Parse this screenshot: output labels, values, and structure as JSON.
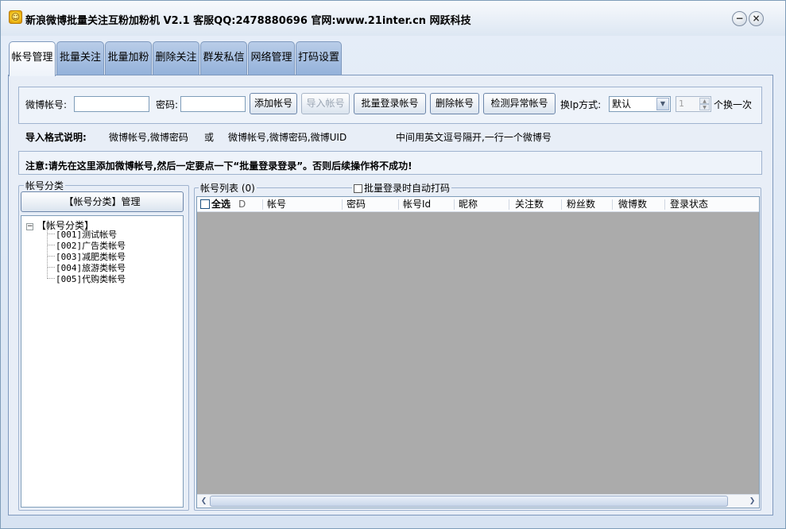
{
  "window": {
    "title": "新浪微博批量关注互粉加粉机 V2.1 客服QQ:2478880696 官网:www.21inter.cn 网跃科技",
    "icon": "app-smiley-icon",
    "minimize": "−",
    "close": "×"
  },
  "tabs": [
    "帐号管理",
    "批量关注",
    "批量加粉",
    "删除关注",
    "群发私信",
    "网络管理",
    "打码设置"
  ],
  "account_form": {
    "weibo_label": "微博帐号:",
    "weibo_value": "",
    "password_label": "密码:",
    "password_value": "",
    "add_button": "添加帐号",
    "import_button": "导入帐号",
    "batch_login_button": "批量登录帐号",
    "delete_button": "删除帐号",
    "check_button": "检测异常帐号",
    "ip_label": "换Ip方式:",
    "ip_mode": "默认",
    "spin_value": "1",
    "spin_suffix": "个换一次"
  },
  "import_note": {
    "label": "导入格式说明:",
    "format1": "微博帐号,微博密码",
    "or": "或",
    "format2": "微博帐号,微博密码,微博UID",
    "hint": "中间用英文逗号隔开,一行一个微博号"
  },
  "notice": "注意:请先在这里添加微博帐号,然后一定要点一下“批量登录登录”。否则后续操作将不成功!",
  "category": {
    "group_title": "帐号分类",
    "manage_button": "【帐号分类】管理",
    "root": "【帐号分类】",
    "toggle": "−",
    "items": [
      "[001]测试帐号",
      "[002]广告类帐号",
      "[003]减肥类帐号",
      "[004]旅游类帐号",
      "[005]代购类帐号"
    ]
  },
  "account_list": {
    "group_title": "帐号列表 (0)",
    "auto_captcha_label": "批量登录时自动打码",
    "select_all": "全选",
    "columns": [
      "D",
      "帐号",
      "密码",
      "帐号Id",
      "昵称",
      "关注数",
      "粉丝数",
      "微博数",
      "登录状态"
    ]
  }
}
